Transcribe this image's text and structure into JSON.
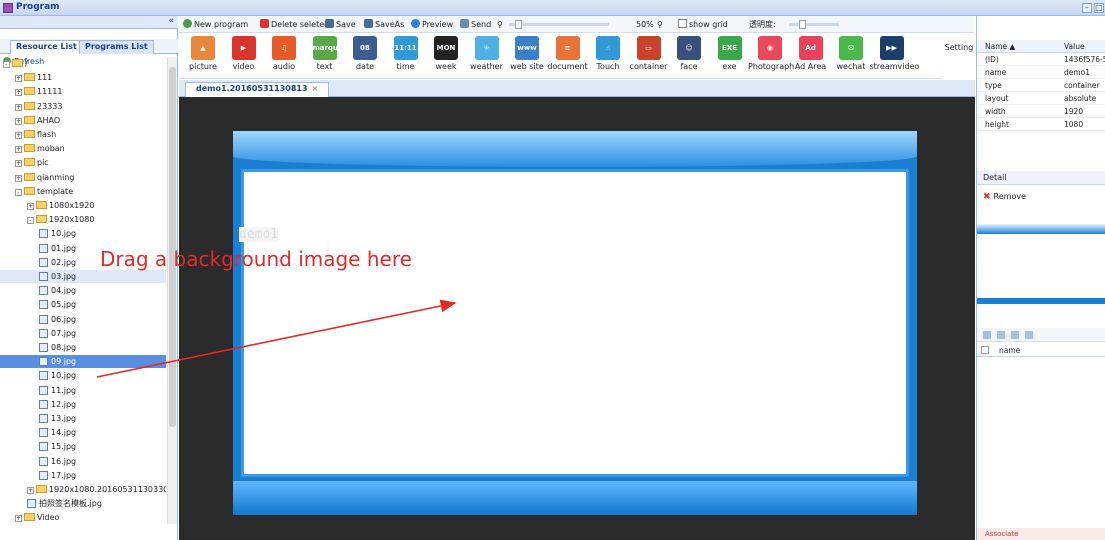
{
  "window": {
    "title": "Program"
  },
  "left": {
    "tabs": [
      "Resource List",
      "Programs List"
    ],
    "refresh": "Refresh",
    "tree": [
      {
        "label": "/",
        "level": 0,
        "kind": "folder",
        "exp": "-"
      },
      {
        "label": "111",
        "level": 1,
        "kind": "folder",
        "exp": "+"
      },
      {
        "label": "11111",
        "level": 1,
        "kind": "folder",
        "exp": "+"
      },
      {
        "label": "23333",
        "level": 1,
        "kind": "folder",
        "exp": "+"
      },
      {
        "label": "AHAO",
        "level": 1,
        "kind": "folder",
        "exp": "+"
      },
      {
        "label": "flash",
        "level": 1,
        "kind": "folder",
        "exp": "+"
      },
      {
        "label": "moban",
        "level": 1,
        "kind": "folder",
        "exp": "+"
      },
      {
        "label": "pic",
        "level": 1,
        "kind": "folder",
        "exp": "+"
      },
      {
        "label": "qianming",
        "level": 1,
        "kind": "folder",
        "exp": "+"
      },
      {
        "label": "template",
        "level": 1,
        "kind": "folder",
        "exp": "-"
      },
      {
        "label": "1080x1920",
        "level": 2,
        "kind": "folder",
        "exp": "+"
      },
      {
        "label": "1920x1080",
        "level": 2,
        "kind": "folder",
        "exp": "-"
      },
      {
        "label": "10.jpg",
        "level": 3,
        "kind": "file"
      },
      {
        "label": "01.jpg",
        "level": 3,
        "kind": "file"
      },
      {
        "label": "02.jpg",
        "level": 3,
        "kind": "file"
      },
      {
        "label": "03.jpg",
        "level": 3,
        "kind": "file",
        "state": "sel"
      },
      {
        "label": "04.jpg",
        "level": 3,
        "kind": "file"
      },
      {
        "label": "05.jpg",
        "level": 3,
        "kind": "file"
      },
      {
        "label": "06.jpg",
        "level": 3,
        "kind": "file"
      },
      {
        "label": "07.jpg",
        "level": 3,
        "kind": "file"
      },
      {
        "label": "08.jpg",
        "level": 3,
        "kind": "file"
      },
      {
        "label": "09.jpg",
        "level": 3,
        "kind": "file",
        "state": "hl"
      },
      {
        "label": "10.jpg",
        "level": 3,
        "kind": "file"
      },
      {
        "label": "11.jpg",
        "level": 3,
        "kind": "file"
      },
      {
        "label": "12.jpg",
        "level": 3,
        "kind": "file"
      },
      {
        "label": "13.jpg",
        "level": 3,
        "kind": "file"
      },
      {
        "label": "14.jpg",
        "level": 3,
        "kind": "file"
      },
      {
        "label": "15.jpg",
        "level": 3,
        "kind": "file"
      },
      {
        "label": "16.jpg",
        "level": 3,
        "kind": "file"
      },
      {
        "label": "17.jpg",
        "level": 3,
        "kind": "file"
      },
      {
        "label": "1920x1080.20160531130330",
        "level": 2,
        "kind": "folder",
        "exp": "+"
      },
      {
        "label": "拍照签名模板.jpg",
        "level": 2,
        "kind": "file"
      },
      {
        "label": "Video",
        "level": 1,
        "kind": "folder",
        "exp": "+"
      }
    ]
  },
  "toolbar": {
    "new_program": "New program",
    "delete_selected": "Delete seleted",
    "save": "Save",
    "save_as": "SaveAs",
    "preview": "Preview",
    "send": "Send",
    "zoom": "50%",
    "show_grid": "show grid",
    "opacity": "透明度:"
  },
  "palette": [
    {
      "label": "picture",
      "color": "#e8863a",
      "glyph": "▲"
    },
    {
      "label": "video",
      "color": "#d9342b",
      "glyph": "▶"
    },
    {
      "label": "audio",
      "color": "#e85a2a",
      "glyph": "♫"
    },
    {
      "label": "text",
      "color": "#5aa84a",
      "glyph": "marquee"
    },
    {
      "label": "date",
      "color": "#3a5f8f",
      "glyph": "08"
    },
    {
      "label": "time",
      "color": "#2f9ad6",
      "glyph": "11:11"
    },
    {
      "label": "week",
      "color": "#222222",
      "glyph": "MON"
    },
    {
      "label": "weather",
      "color": "#4fb0e8",
      "glyph": "☀"
    },
    {
      "label": "web site",
      "color": "#3a7fc8",
      "glyph": "www"
    },
    {
      "label": "document",
      "color": "#e8743a",
      "glyph": "≡"
    },
    {
      "label": "Touch",
      "color": "#2f9ad6",
      "glyph": "☝"
    },
    {
      "label": "container",
      "color": "#c8432a",
      "glyph": "▭"
    },
    {
      "label": "face",
      "color": "#3a4f7a",
      "glyph": "☺"
    },
    {
      "label": "exe",
      "color": "#3aa84a",
      "glyph": "EXE"
    },
    {
      "label": "Photograph",
      "color": "#e84a5a",
      "glyph": "◉"
    },
    {
      "label": "Ad Area",
      "color": "#e8435a",
      "glyph": "Ad"
    },
    {
      "label": "wechat",
      "color": "#4ab84a",
      "glyph": "✉"
    },
    {
      "label": "streamvideo",
      "color": "#1a3f6a",
      "glyph": "▶▶"
    }
  ],
  "setting": "Setting",
  "doc_tab": "demo1.20160531130813",
  "canvas": {
    "demo_label": "demo1",
    "hint": "Drag a background image here"
  },
  "properties": {
    "headers": [
      "Name ▲",
      "Value"
    ],
    "rows": [
      {
        "k": "(ID)",
        "v": "1436f576-5"
      },
      {
        "k": "name",
        "v": "demo1"
      },
      {
        "k": "type",
        "v": "container"
      },
      {
        "k": "layout",
        "v": "absolute"
      },
      {
        "k": "width",
        "v": "1920"
      },
      {
        "k": "height",
        "v": "1080"
      }
    ]
  },
  "detail": "Detail",
  "remove": "Remove",
  "name_header": "name",
  "associate": "Associate"
}
